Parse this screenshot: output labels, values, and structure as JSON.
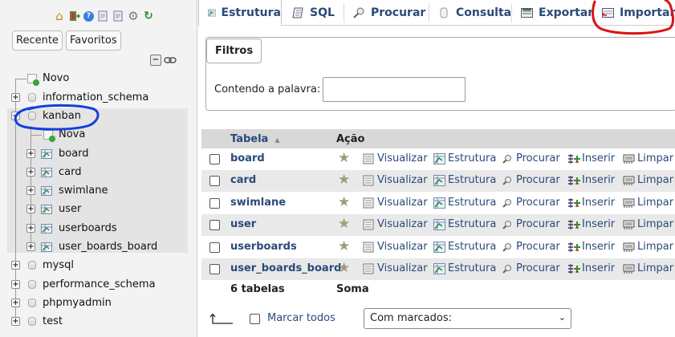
{
  "nav": {
    "icons": [
      "home-icon",
      "exit-icon",
      "help-icon",
      "docs-icon",
      "settings-icon",
      "reload-icon"
    ],
    "tabs": [
      "Recente",
      "Favoritos"
    ],
    "collapse_label": "collapse-all",
    "tree": [
      {
        "label": "Novo",
        "type": "new"
      },
      {
        "label": "information_schema",
        "type": "db"
      },
      {
        "label": "kanban",
        "type": "db",
        "expanded": true
      },
      {
        "label": "Nova",
        "type": "new"
      },
      {
        "label": "board",
        "type": "table"
      },
      {
        "label": "card",
        "type": "table"
      },
      {
        "label": "swimlane",
        "type": "table"
      },
      {
        "label": "user",
        "type": "table"
      },
      {
        "label": "userboards",
        "type": "table"
      },
      {
        "label": "user_boards_board",
        "type": "table"
      },
      {
        "label": "mysql",
        "type": "db"
      },
      {
        "label": "performance_schema",
        "type": "db"
      },
      {
        "label": "phpmyadmin",
        "type": "db"
      },
      {
        "label": "test",
        "type": "db"
      }
    ]
  },
  "menu": {
    "tabs": [
      {
        "label": "Estrutura",
        "icon": "structure-icon",
        "active": true
      },
      {
        "label": "SQL",
        "icon": "sql-icon"
      },
      {
        "label": "Procurar",
        "icon": "search-icon"
      },
      {
        "label": "Consulta",
        "icon": "query-icon"
      },
      {
        "label": "Exportar",
        "icon": "export-icon"
      },
      {
        "label": "Importar",
        "icon": "import-icon"
      }
    ]
  },
  "filters": {
    "legend": "Filtros",
    "label": "Contendo a palavra:",
    "value": ""
  },
  "table": {
    "headers": {
      "name": "Tabela",
      "action": "Ação"
    },
    "actions": [
      "Visualizar",
      "Estrutura",
      "Procurar",
      "Inserir",
      "Limpar"
    ],
    "rows": [
      "board",
      "card",
      "swimlane",
      "user",
      "userboards",
      "user_boards_board"
    ],
    "footer": {
      "count": "6 tabelas",
      "sum": "Soma"
    }
  },
  "bulk": {
    "mark_all": "Marcar todos",
    "with_selected": "Com marcados:"
  },
  "colors": {
    "link": "#2a4a7a",
    "annotation_red": "#d91414",
    "annotation_blue": "#1440d9"
  }
}
